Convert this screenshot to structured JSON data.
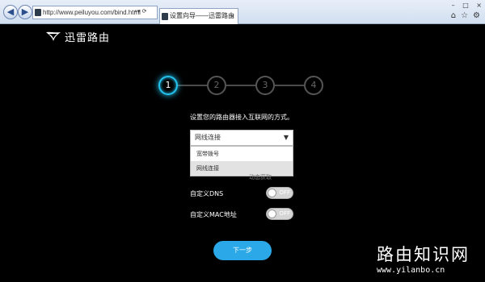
{
  "browser": {
    "url": "http://www.peiluyou.com/bind.html",
    "tab_title": "设置向导——迅雷路由",
    "back_icon": "back-arrow-icon",
    "forward_icon": "forward-arrow-icon",
    "tab_close": "×",
    "window_controls": [
      "–",
      "□",
      "×"
    ],
    "toolbar_icons": [
      "home-icon",
      "star-icon",
      "gear-icon"
    ]
  },
  "brand": {
    "name": "迅雷路由",
    "color": "#ffffff"
  },
  "wizard": {
    "steps": [
      "1",
      "2",
      "3",
      "4"
    ],
    "active_step": 1,
    "accent_color": "#25c4f0",
    "instruction": "设置您的路由器接入互联网的方式。",
    "connection_select": {
      "value": "网线连接",
      "options": [
        "宽带拨号",
        "网线连接"
      ],
      "highlighted_option": "网线连接"
    },
    "hidden_text": "动态获取",
    "custom_dns": {
      "label": "自定义DNS",
      "toggle": "OFF"
    },
    "custom_mac": {
      "label": "自定义MAC地址",
      "toggle": "OFF"
    },
    "next_button": "下一步",
    "next_button_color": "#2aa8e8"
  },
  "watermark": {
    "title": "路由知识网",
    "url": "www.yilanbo.cn"
  }
}
